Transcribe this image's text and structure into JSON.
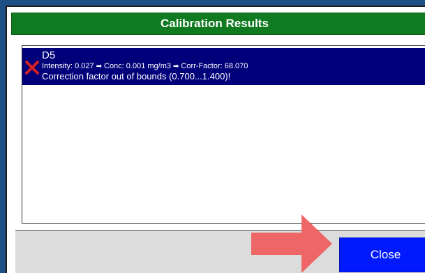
{
  "dialog": {
    "title": "Calibration Results",
    "close_label": "Close"
  },
  "results": [
    {
      "name": "D5",
      "status_icon": "x-icon",
      "status": "error",
      "detail": {
        "intensity": "Intensity: 0.027",
        "conc": "Conc: 0.001 mg/m3",
        "corr_factor": "Corr-Factor: 68.070"
      },
      "message": "Correction factor out of bounds (0.700...1.400)!"
    }
  ],
  "colors": {
    "header_bg": "#0f7a1f",
    "selected_row_bg": "#00007a",
    "close_button_bg": "#0019ff",
    "error_icon": "#d42020",
    "pointer_arrow": "#ef6666"
  }
}
